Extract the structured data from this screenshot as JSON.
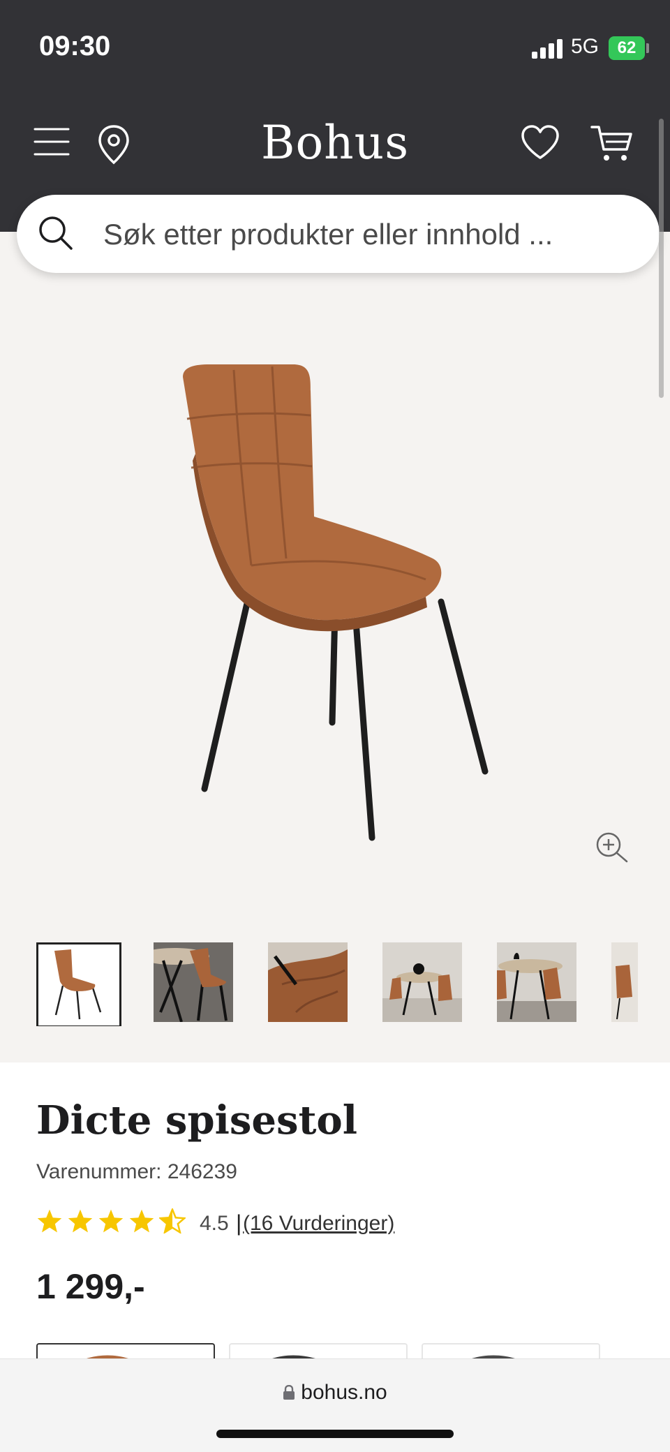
{
  "status": {
    "time": "09:30",
    "network": "5G",
    "battery": "62"
  },
  "header": {
    "logo": "Bohus",
    "menu_icon": "hamburger-menu-icon",
    "location_icon": "map-pin-icon",
    "wishlist_icon": "heart-icon",
    "cart_icon": "shopping-cart-icon"
  },
  "search": {
    "placeholder": "Søk etter produkter eller innhold ..."
  },
  "gallery": {
    "zoom_icon": "zoom-in-icon",
    "thumbnail_count": 6,
    "active_thumbnail": 1
  },
  "product": {
    "title": "Dicte spisestol",
    "sku": "Varenummer: 246239",
    "rating": 4.5,
    "rating_text": "4.5",
    "separator": "|",
    "reviews": "(16 Vurderinger)",
    "price": "1 299,-"
  },
  "browser": {
    "url": "bohus.no"
  },
  "colors": {
    "header_bg": "#323236",
    "hero_bg": "#f5f3f1",
    "star": "#f7c600",
    "chair_leather": "#b06a3e"
  }
}
